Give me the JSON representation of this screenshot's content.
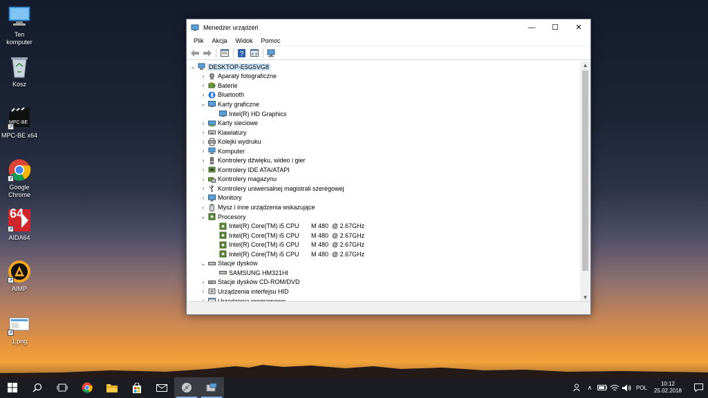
{
  "desktop": {
    "icons": [
      {
        "label": "Ten\nkomputer",
        "icon": "computer-icon"
      },
      {
        "label": "Kosz",
        "icon": "recycle-bin-icon"
      },
      {
        "label": "MPC-BE x64",
        "icon": "mpc-be-icon",
        "badge": "MPC·BE"
      },
      {
        "label": "Google\nChrome",
        "icon": "chrome-icon"
      },
      {
        "label": "AIDA64",
        "icon": "aida64-icon",
        "badge": "64"
      },
      {
        "label": "AIMP",
        "icon": "aimp-icon"
      },
      {
        "label": "1.png",
        "icon": "image-file-icon"
      }
    ]
  },
  "window": {
    "title": "Menedżer urządzeń",
    "menu": [
      "Plik",
      "Akcja",
      "Widok",
      "Pomoc"
    ],
    "toolbar": [
      "back-icon",
      "forward-icon",
      "properties-icon",
      "help-icon",
      "view-icon",
      "monitor-scan-icon"
    ],
    "tree": {
      "root": "DESKTOP-E5G5VG8",
      "rows": [
        {
          "label": "Aparaty fotograficzne",
          "level": 1,
          "expanded": false,
          "icon": "camera-icon"
        },
        {
          "label": "Baterie",
          "level": 1,
          "expanded": false,
          "icon": "battery-icon"
        },
        {
          "label": "Bluetooth",
          "level": 1,
          "expanded": false,
          "icon": "bluetooth-icon"
        },
        {
          "label": "Karty graficzne",
          "level": 1,
          "expanded": true,
          "icon": "display-adapter-icon"
        },
        {
          "label": "Intel(R) HD Graphics",
          "level": 2,
          "icon": "display-adapter-icon"
        },
        {
          "label": "Karty sieciowe",
          "level": 1,
          "expanded": false,
          "icon": "network-adapter-icon"
        },
        {
          "label": "Klawiatury",
          "level": 1,
          "expanded": false,
          "icon": "keyboard-icon"
        },
        {
          "label": "Kolejki wydruku",
          "level": 1,
          "expanded": false,
          "icon": "printer-icon"
        },
        {
          "label": "Komputer",
          "level": 1,
          "expanded": false,
          "icon": "computer-icon"
        },
        {
          "label": "Kontrolery dźwięku, wideo i gier",
          "level": 1,
          "expanded": false,
          "icon": "speaker-icon"
        },
        {
          "label": "Kontrolery IDE ATA/ATAPI",
          "level": 1,
          "expanded": false,
          "icon": "ide-controller-icon"
        },
        {
          "label": "Kontrolery magazynu",
          "level": 1,
          "expanded": false,
          "icon": "storage-controller-icon"
        },
        {
          "label": "Kontrolery uniwersalnej magistrali szeregowej",
          "level": 1,
          "expanded": false,
          "icon": "usb-icon"
        },
        {
          "label": "Monitory",
          "level": 1,
          "expanded": false,
          "icon": "monitor-icon"
        },
        {
          "label": "Mysz i inne urządzenia wskazujące",
          "level": 1,
          "expanded": false,
          "icon": "mouse-icon"
        },
        {
          "label": "Procesory",
          "level": 1,
          "expanded": true,
          "icon": "processor-icon"
        },
        {
          "label": "Intel(R) Core(TM) i5 CPU       M 480  @ 2.67GHz",
          "level": 2,
          "icon": "processor-icon"
        },
        {
          "label": "Intel(R) Core(TM) i5 CPU       M 480  @ 2.67GHz",
          "level": 2,
          "icon": "processor-icon"
        },
        {
          "label": "Intel(R) Core(TM) i5 CPU       M 480  @ 2.67GHz",
          "level": 2,
          "icon": "processor-icon"
        },
        {
          "label": "Intel(R) Core(TM) i5 CPU       M 480  @ 2.67GHz",
          "level": 2,
          "icon": "processor-icon"
        },
        {
          "label": "Stacje dysków",
          "level": 1,
          "expanded": true,
          "icon": "disk-drive-icon"
        },
        {
          "label": "SAMSUNG HM321HI",
          "level": 2,
          "icon": "disk-drive-icon"
        },
        {
          "label": "Stacje dysków CD-ROM/DVD",
          "level": 1,
          "expanded": false,
          "icon": "dvd-icon"
        },
        {
          "label": "Urządzenia interfejsu HID",
          "level": 1,
          "expanded": false,
          "icon": "hid-icon"
        },
        {
          "label": "Urządzenia programowe",
          "level": 1,
          "expanded": false,
          "icon": "software-device-icon"
        }
      ]
    }
  },
  "taskbar": {
    "apps": [
      "start-icon",
      "search-icon",
      "task-view-icon",
      "chrome-icon",
      "file-explorer-icon",
      "store-icon",
      "mail-icon",
      "media-player-icon",
      "device-manager-icon"
    ],
    "language": "POL",
    "time": "10:12",
    "date": "25.02.2018"
  }
}
